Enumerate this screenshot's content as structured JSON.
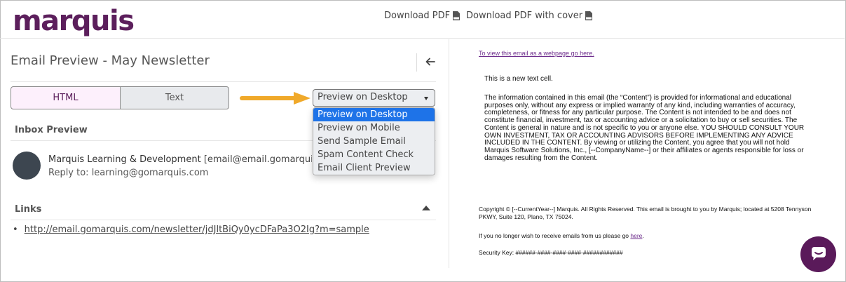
{
  "brand": {
    "logo_text": "marquis",
    "logo_color": "#5c1f5c"
  },
  "header": {
    "download_pdf": "Download PDF",
    "download_pdf_cover": "Download PDF with cover",
    "pdf_icon": "pdf-file-icon"
  },
  "panel": {
    "title": "Email Preview - May Newsletter",
    "back_icon": "arrow-left-icon"
  },
  "tabs": {
    "html": "HTML",
    "text": "Text",
    "active": "HTML"
  },
  "preview_select": {
    "selected": "Preview on Desktop",
    "options": [
      "Preview on Desktop",
      "Preview on Mobile",
      "Send Sample Email",
      "Spam Content Check",
      "Email Client Preview"
    ],
    "highlight_color": "#1e73e8"
  },
  "callout_arrow_color": "#f0a92a",
  "inbox": {
    "label": "Inbox Preview",
    "sender_name": "Marquis Learning & Development",
    "sender_email": "[email@email.gomarquis.com",
    "reply_to": "Reply to: learning@gomarquis.com"
  },
  "links": {
    "label": "Links",
    "items": [
      "http://email.gomarquis.com/newsletter/jdJltBiQy0ycDFaPa3O2Ig?m=sample"
    ]
  },
  "email": {
    "webpage_link": "To view this email as a webpage go here.",
    "cell_text": "This is a new text cell.",
    "disclaimer": "The information contained in this email (the “Content”) is provided for informational and educational purposes only, without any express or implied warranty of any kind, including warranties of accuracy, completeness, or fitness for any particular purpose. The Content is not intended to be and does not constitute financial, investment, tax or accounting advice or a solicitation to buy or sell securities. The Content is general in nature and is not specific to you or anyone else. YOU SHOULD CONSULT YOUR OWN INVESTMENT, TAX OR ACCOUNTING ADVISORS BEFORE IMPLEMENTING ANY ADVICE INCLUDED IN THE CONTENT. By viewing or utilizing the Content, you agree that you will not hold Marquis Software Solutions, Inc., [--CompanyName--] or their affiliates or agents responsible for loss or damages resulting from the Content.",
    "copyright": "Copyright © [--CurrentYear--] Marquis. All Rights Reserved. This email is brought to you by Marquis; located at 5208 Tennyson PKWY, Suite 120, Plano, TX 75024.",
    "unsubscribe_prefix": "If you no longer wish to receive emails from us please go ",
    "unsubscribe_link": "here",
    "unsubscribe_suffix": ".",
    "security_key": "Security Key: ######-####-####-####-############"
  },
  "chat": {
    "icon": "chat-bubble-icon",
    "color": "#5a1a5a"
  }
}
